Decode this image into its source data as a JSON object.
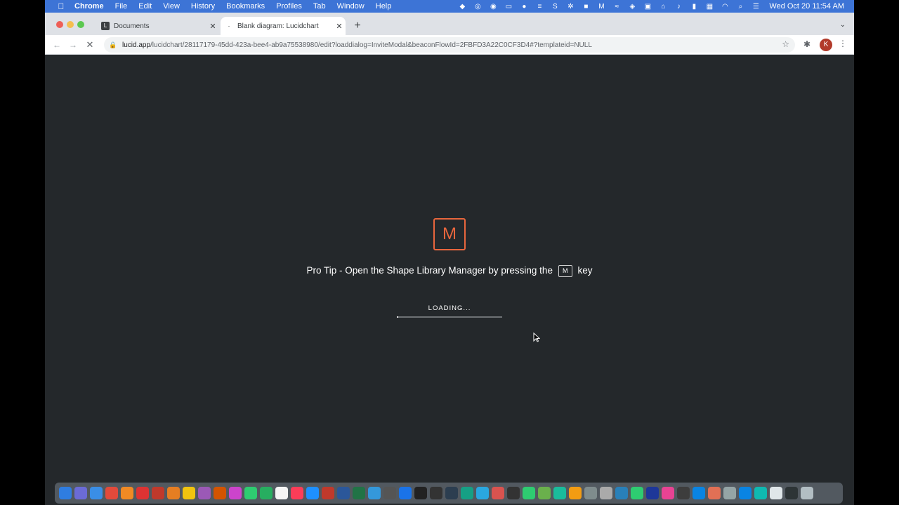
{
  "menubar": {
    "apple": "",
    "app": "Chrome",
    "items": [
      "File",
      "Edit",
      "View",
      "History",
      "Bookmarks",
      "Profiles",
      "Tab",
      "Window",
      "Help"
    ],
    "clock": "Wed Oct 20  11:54 AM"
  },
  "tabs": [
    {
      "title": "Documents",
      "favicon": "L",
      "close": "✕"
    },
    {
      "title": "Blank diagram: Lucidchart",
      "favicon": "·",
      "close": "✕"
    }
  ],
  "new_tab": "+",
  "tab_menu": "⌄",
  "toolbar": {
    "back": "←",
    "forward": "→",
    "reload": "✕",
    "lock": "🔒",
    "url_host": "lucid.app",
    "url_path": "/lucidchart/28117179-45dd-423a-bee4-ab9a75538980/edit?loaddialog=InviteModal&beaconFlowId=2FBFD3A22C0CF3D4#?templateid=NULL",
    "star": "☆",
    "extensions": "✱",
    "avatar": "K",
    "menu": "⋮"
  },
  "loader": {
    "key_letter": "M",
    "tip_before": "Pro Tip - Open the Shape Library Manager by pressing the",
    "tip_key": "M",
    "tip_after": "key",
    "loading_text": "LOADING...",
    "progress": 0.01
  },
  "colors": {
    "accent": "#e8663d",
    "background": "#24282b",
    "menubar": "#3d74d6"
  },
  "dock_colors": [
    "#2f7de1",
    "#6b6bd6",
    "#3a8ee6",
    "#e24a3b",
    "#f08a24",
    "#d33",
    "#c0392b",
    "#e67e22",
    "#f1c40f",
    "#9b59b6",
    "#d35400",
    "#cc44cc",
    "#2ecc71",
    "#27ae60",
    "#f5f5f5",
    "#fc3d58",
    "#1e90ff",
    "#c0392b",
    "#2b579a",
    "#217346",
    "#3498db",
    "#555",
    "#1a73e8",
    "#222",
    "#333",
    "#2c3e50",
    "#16a085",
    "#2aa7e0",
    "#d9534f",
    "#333",
    "#2ecc71",
    "#6ab04c",
    "#1abc9c",
    "#f39c12",
    "#7f8c8d",
    "#aaa",
    "#2980b9",
    "#2ecc71",
    "#1e3799",
    "#e84393",
    "#3d3d3d",
    "#0984e3",
    "#e17055",
    "#95a5a6",
    "#0984e3",
    "#0fb9b1",
    "#dfe6e9",
    "#2d3436",
    "#b2bec3"
  ]
}
